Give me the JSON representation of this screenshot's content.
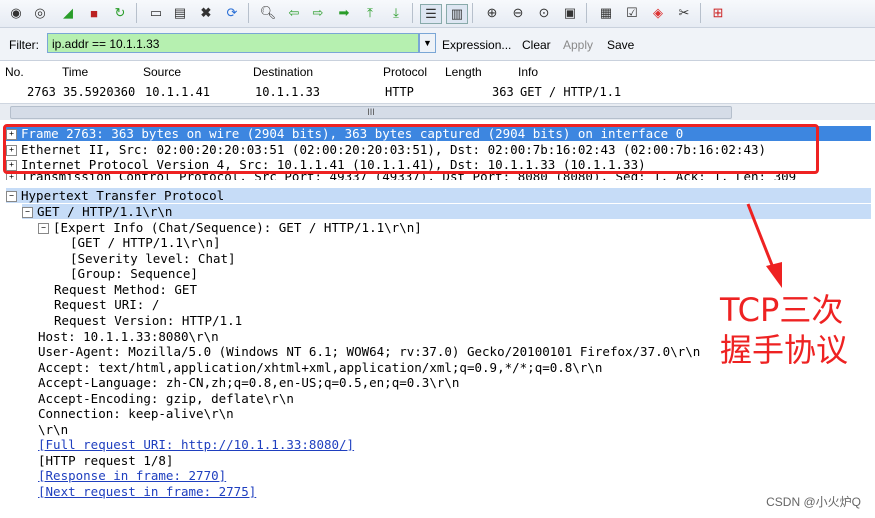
{
  "filter": {
    "label": "Filter:",
    "value": "ip.addr == 10.1.1.33",
    "buttons": [
      "Expression...",
      "Clear",
      "Apply",
      "Save"
    ]
  },
  "packet_list": {
    "headers": [
      "No.",
      "Time",
      "Source",
      "Destination",
      "Protocol",
      "Length",
      "Info"
    ],
    "rows": [
      [
        "2763",
        "35.5920360",
        "10.1.1.41",
        "10.1.1.33",
        "HTTP",
        "363",
        "GET / HTTP/1.1"
      ]
    ],
    "scroll_label": "III"
  },
  "details": {
    "frame": "Frame 2763: 363 bytes on wire (2904 bits), 363 bytes captured (2904 bits) on interface 0",
    "ethernet": "Ethernet II, Src: 02:00:20:20:03:51 (02:00:20:20:03:51), Dst: 02:00:7b:16:02:43 (02:00:7b:16:02:43)",
    "ip": "Internet Protocol Version 4, Src: 10.1.1.41 (10.1.1.41), Dst: 10.1.1.33 (10.1.1.33)",
    "tcp": "Transmission Control Protocol, Src Port: 49337 (49337), Dst Port: 8080 (8080), Seq: 1, Ack: 1, Len: 309",
    "http": "Hypertext Transfer Protocol",
    "get": "GET / HTTP/1.1\\r\\n",
    "expert": "[Expert Info (Chat/Sequence): GET / HTTP/1.1\\r\\n]",
    "expert_msg": "[GET / HTTP/1.1\\r\\n]",
    "severity": "[Severity level: Chat]",
    "group": "[Group: Sequence]",
    "method": "Request Method: GET",
    "uri": "Request URI: /",
    "version": "Request Version: HTTP/1.1",
    "host": "Host: 10.1.1.33:8080\\r\\n",
    "ua": "User-Agent: Mozilla/5.0 (Windows NT 6.1; WOW64; rv:37.0) Gecko/20100101 Firefox/37.0\\r\\n",
    "accept": "Accept: text/html,application/xhtml+xml,application/xml;q=0.9,*/*;q=0.8\\r\\n",
    "accept_lang": "Accept-Language: zh-CN,zh;q=0.8,en-US;q=0.5,en;q=0.3\\r\\n",
    "accept_enc": "Accept-Encoding: gzip, deflate\\r\\n",
    "connection": "Connection: keep-alive\\r\\n",
    "crlf": "\\r\\n",
    "full_uri": "[Full request URI: http://10.1.1.33:8080/]",
    "http_req": "[HTTP request 1/8]",
    "response": "[Response in frame: 2770]",
    "next_req": "[Next request in frame: 2775]"
  },
  "annotation": {
    "line1": "TCP三次",
    "line2": "握手协议",
    "color": "#ee2222"
  },
  "watermark": "CSDN @小火炉Q"
}
